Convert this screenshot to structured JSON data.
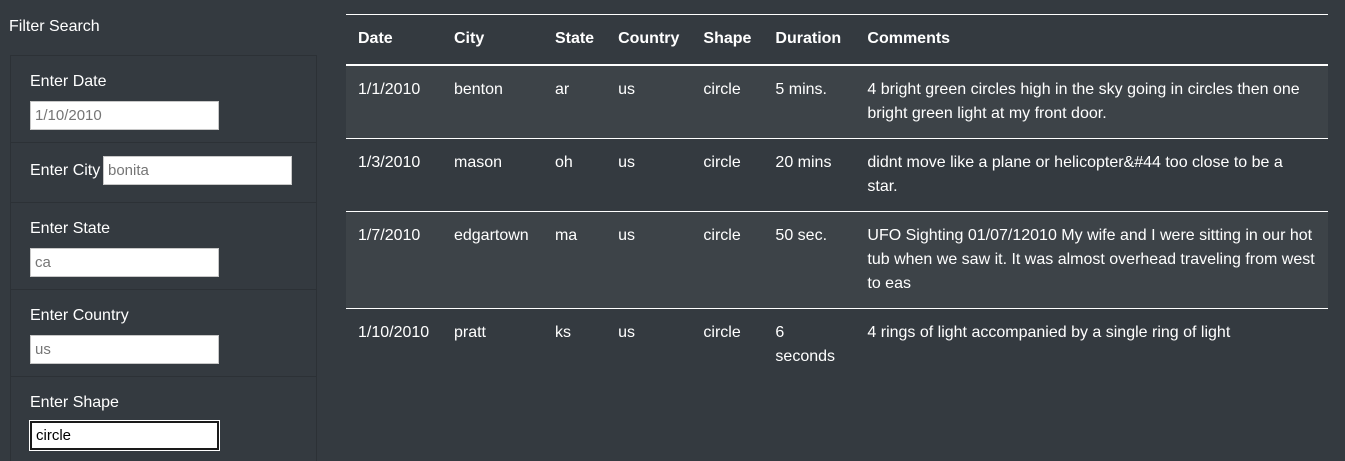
{
  "filter": {
    "title": "Filter Search",
    "date": {
      "label": "Enter Date",
      "placeholder": "1/10/2010"
    },
    "city": {
      "label": "Enter City",
      "placeholder": "bonita"
    },
    "state": {
      "label": "Enter State",
      "placeholder": "ca"
    },
    "country": {
      "label": "Enter Country",
      "placeholder": "us"
    },
    "shape": {
      "label": "Enter Shape",
      "value": "circle"
    }
  },
  "table": {
    "headers": [
      "Date",
      "City",
      "State",
      "Country",
      "Shape",
      "Duration",
      "Comments"
    ],
    "rows": [
      [
        "1/1/2010",
        "benton",
        "ar",
        "us",
        "circle",
        "5 mins.",
        "4 bright green circles high in the sky going in circles then one bright green light at my front door."
      ],
      [
        "1/3/2010",
        "mason",
        "oh",
        "us",
        "circle",
        "20 mins",
        "didnt move like a plane or helicopter&#44 too close to be a star."
      ],
      [
        "1/7/2010",
        "edgartown",
        "ma",
        "us",
        "circle",
        "50 sec.",
        "UFO Sighting 01/07/12010 My wife and I were sitting in our hot tub when we saw it. It was almost overhead traveling from west to eas"
      ],
      [
        "1/10/2010",
        "pratt",
        "ks",
        "us",
        "circle",
        "6 seconds",
        "4 rings of light accompanied by a single ring of light"
      ]
    ]
  }
}
